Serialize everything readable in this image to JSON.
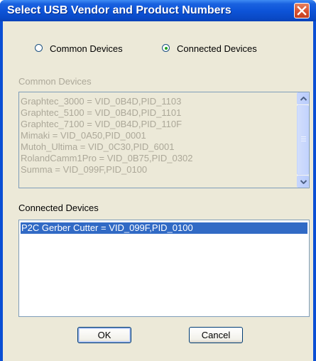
{
  "window": {
    "title": "Select USB Vendor and Product Numbers",
    "close_icon": "close-icon"
  },
  "mode": {
    "options": [
      {
        "label": "Common Devices",
        "selected": false
      },
      {
        "label": "Connected Devices",
        "selected": true
      }
    ]
  },
  "common_devices": {
    "label": "Common Devices",
    "enabled": false,
    "items": [
      "Graphtec_3000 = VID_0B4D,PID_1103",
      "Graphtec_5100 = VID_0B4D,PID_1101",
      "Graphtec_7100 = VID_0B4D,PID_110F",
      "Mimaki = VID_0A50,PID_0001",
      "Mutoh_Ultima = VID_0C30,PID_6001",
      "RolandCamm1Pro = VID_0B75,PID_0302",
      "Summa = VID_099F,PID_0100"
    ]
  },
  "connected_devices": {
    "label": "Connected Devices",
    "items": [
      "P2C Gerber Cutter = VID_099F,PID_0100"
    ],
    "selected_index": 0
  },
  "buttons": {
    "ok": "OK",
    "cancel": "Cancel"
  },
  "colors": {
    "title_bar": "#0a4fd4",
    "client_bg": "#ece9d8",
    "selection": "#316ac5",
    "disabled_text": "#aca899"
  }
}
